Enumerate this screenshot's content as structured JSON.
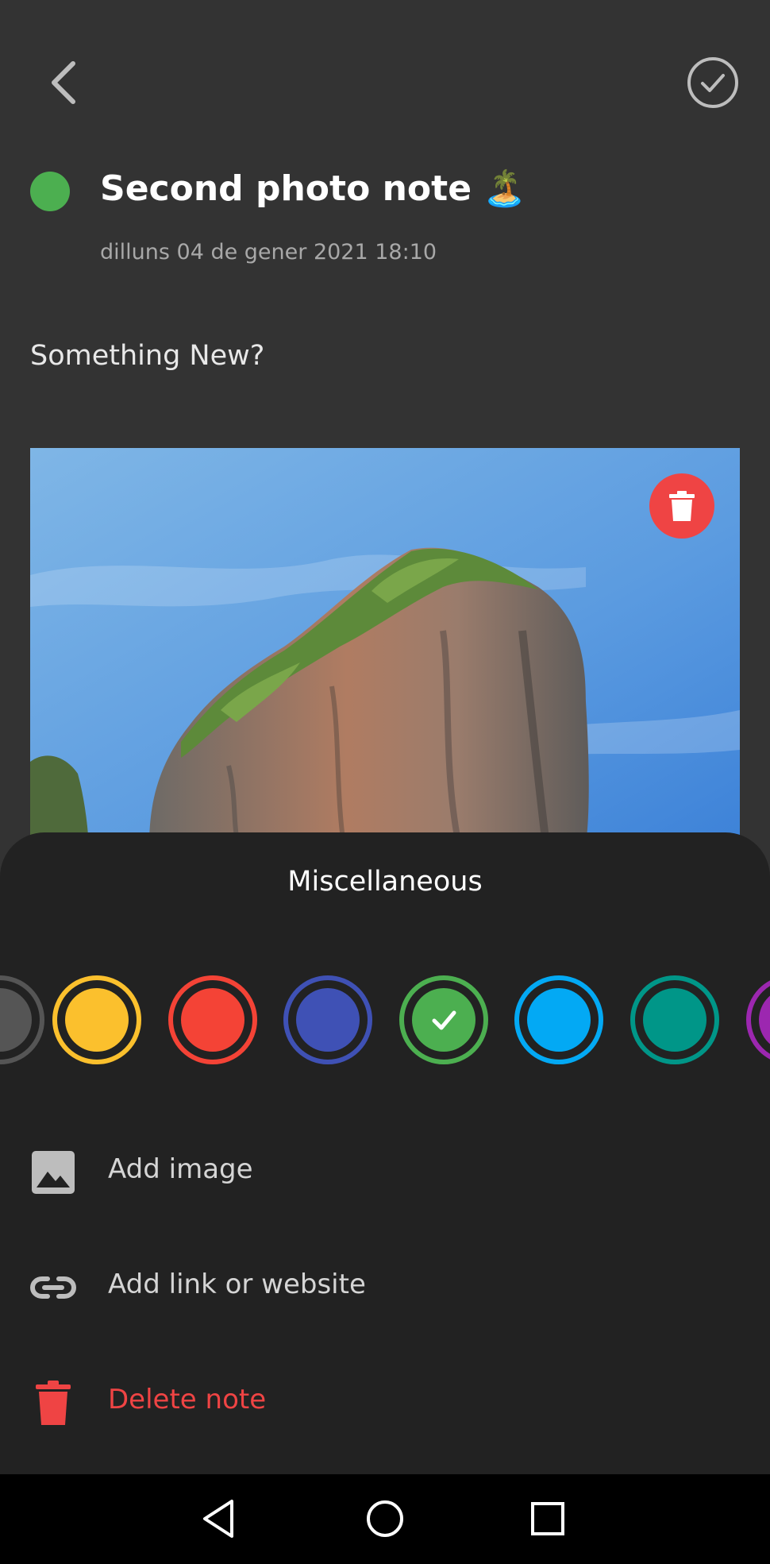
{
  "header": {
    "back_icon": "chevron-left-icon",
    "done_icon": "check-circle-icon"
  },
  "note": {
    "color": "#4CAF50",
    "title": "Second photo note",
    "title_emoji": "🏝️",
    "date": "dilluns 04 de gener 2021 18:10",
    "body": "Something New?",
    "delete_image_icon": "trash-icon"
  },
  "sheet": {
    "title": "Miscellaneous",
    "color_options": [
      {
        "color": "#555555",
        "selected": false
      },
      {
        "color": "#FBC02D",
        "selected": false
      },
      {
        "color": "#F44336",
        "selected": false
      },
      {
        "color": "#3F51B5",
        "selected": false
      },
      {
        "color": "#4CAF50",
        "selected": true
      },
      {
        "color": "#03A9F4",
        "selected": false
      },
      {
        "color": "#009688",
        "selected": false
      },
      {
        "color": "#9C27B0",
        "selected": false
      }
    ],
    "actions": {
      "add_image": {
        "label": "Add image",
        "icon": "image-icon"
      },
      "add_link": {
        "label": "Add link or website",
        "icon": "link-icon"
      },
      "delete_note": {
        "label": "Delete note",
        "icon": "trash-icon",
        "color": "#EF4444"
      }
    }
  },
  "navbar": {
    "back": "triangle-back-icon",
    "home": "circle-home-icon",
    "recents": "square-recents-icon"
  }
}
